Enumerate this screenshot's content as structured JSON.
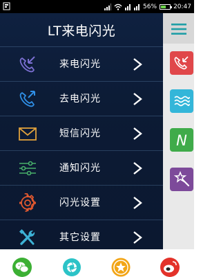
{
  "status_bar": {
    "battery_percent": "56%",
    "time": "20:47",
    "battery_level": 0.56,
    "icons": [
      "notification-icon",
      "signal-icon",
      "wifi-icon",
      "sim-icon",
      "battery-icon"
    ]
  },
  "menu": {
    "title": "LT来电闪光",
    "items": [
      {
        "label": "来电闪光",
        "icon": "incoming-call-icon",
        "color": "#7b6fd2"
      },
      {
        "label": "去电闪光",
        "icon": "outgoing-call-icon",
        "color": "#2f8fe6"
      },
      {
        "label": "短信闪光",
        "icon": "envelope-icon",
        "color": "#e0a13c"
      },
      {
        "label": "通知闪光",
        "icon": "sliders-icon",
        "color": "#48b06a"
      },
      {
        "label": "闪光设置",
        "icon": "gear-icon",
        "color": "#e0582f"
      },
      {
        "label": "其它设置",
        "icon": "tools-icon",
        "color": "#3db2d6"
      }
    ]
  },
  "side_strip": {
    "menu_icon": "hamburger-icon",
    "tiles": [
      {
        "name": "incoming-call-tile",
        "color": "#e0474a"
      },
      {
        "name": "wave-tile",
        "color": "#33b6d9"
      },
      {
        "name": "notification-tile",
        "color": "#3fab4a",
        "glyph": "N"
      },
      {
        "name": "magic-tile",
        "color": "#7d4a9a"
      }
    ]
  },
  "dock": {
    "apps": [
      "wechat-icon",
      "camera-aperture-icon",
      "star-app-icon",
      "weibo-icon"
    ],
    "colors": [
      "#3cb034",
      "#2cc3c7",
      "#f2a516",
      "#e3322a"
    ]
  }
}
